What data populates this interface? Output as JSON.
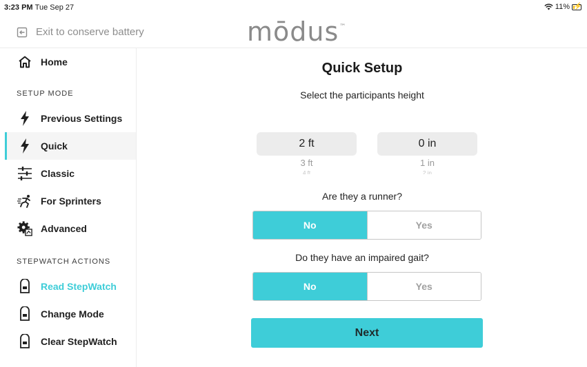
{
  "status_bar": {
    "time": "3:23 PM",
    "date": "Tue Sep 27",
    "battery_percent": "11%"
  },
  "header": {
    "exit_label": "Exit to conserve battery",
    "logo_text": "mōdus",
    "logo_tm": "™"
  },
  "sidebar": {
    "home_label": "Home",
    "setup_mode_heading": "SETUP MODE",
    "setup_items": [
      {
        "label": "Previous Settings",
        "icon": "lightning-icon"
      },
      {
        "label": "Quick",
        "icon": "lightning-icon",
        "active": true
      },
      {
        "label": "Classic",
        "icon": "sliders-icon"
      },
      {
        "label": "For Sprinters",
        "icon": "sprinter-icon"
      },
      {
        "label": "Advanced",
        "icon": "gear-icon"
      }
    ],
    "stepwatch_heading": "STEPWATCH ACTIONS",
    "stepwatch_items": [
      {
        "label": "Read StepWatch",
        "icon": "stepwatch-device-icon",
        "highlighted": true
      },
      {
        "label": "Change Mode",
        "icon": "stepwatch-device-icon"
      },
      {
        "label": "Clear StepWatch",
        "icon": "stepwatch-device-icon"
      }
    ]
  },
  "main": {
    "title": "Quick Setup",
    "height_prompt": "Select the participants height",
    "feet_picker": {
      "selected": "2 ft",
      "next": "3 ft",
      "next2": "4 ft"
    },
    "inches_picker": {
      "selected": "0 in",
      "next": "1 in",
      "next2": "2 in"
    },
    "runner_prompt": "Are they a runner?",
    "runner_toggle": {
      "no_label": "No",
      "yes_label": "Yes",
      "selected": "No"
    },
    "gait_prompt": "Do they have an impaired gait?",
    "gait_toggle": {
      "no_label": "No",
      "yes_label": "Yes",
      "selected": "No"
    },
    "next_label": "Next"
  },
  "colors": {
    "accent": "#3ecdd8",
    "muted_text": "#8d8d8d",
    "battery": "#f5b800"
  }
}
